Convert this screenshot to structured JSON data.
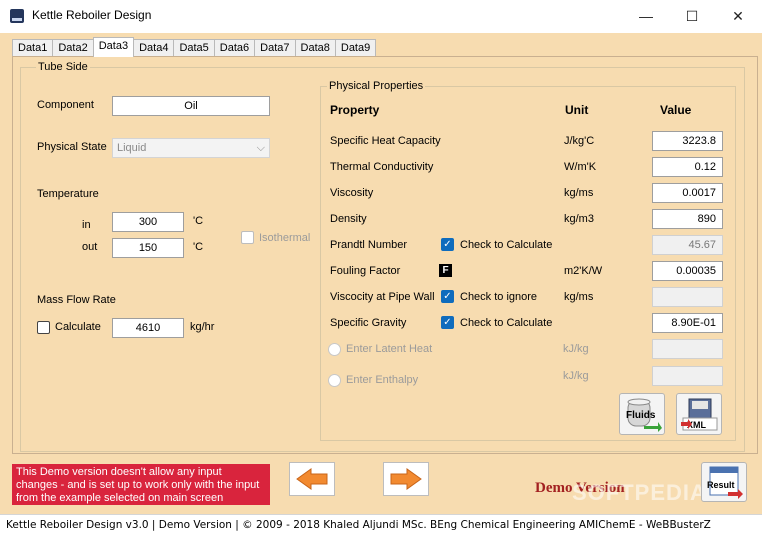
{
  "window": {
    "title": "Kettle Reboiler Design",
    "minimize": "—",
    "maximize": "☐",
    "close": "✕"
  },
  "tabs": [
    "Data1",
    "Data2",
    "Data3",
    "Data4",
    "Data5",
    "Data6",
    "Data7",
    "Data8",
    "Data9"
  ],
  "active_tab": "Data3",
  "tube_side": {
    "title": "Tube Side",
    "component_label": "Component",
    "component_value": "Oil",
    "physical_state_label": "Physical State",
    "physical_state_value": "Liquid",
    "temperature_label": "Temperature",
    "in_label": "in",
    "in_value": "300",
    "out_label": "out",
    "out_value": "150",
    "temp_unit": "'C",
    "isothermal_label": "Isothermal",
    "mass_flow_label": "Mass Flow Rate",
    "calculate_label": "Calculate",
    "mass_flow_value": "4610",
    "mass_flow_unit": "kg/hr"
  },
  "physical_properties": {
    "title": "Physical Properties",
    "col_property": "Property",
    "col_unit": "Unit",
    "col_value": "Value",
    "rows": [
      {
        "name": "Specific Heat Capacity",
        "unit": "J/kg'C",
        "value": "3223.8"
      },
      {
        "name": "Thermal Conductivity",
        "unit": "W/m'K",
        "value": "0.12"
      },
      {
        "name": "Viscosity",
        "unit": "kg/ms",
        "value": "0.0017"
      },
      {
        "name": "Density",
        "unit": "kg/m3",
        "value": "890"
      },
      {
        "name": "Prandtl Number",
        "check": "Check to Calculate",
        "unit": "",
        "value": "45.67"
      },
      {
        "name": "Fouling Factor",
        "icon": "F",
        "unit": "m2'K/W",
        "value": "0.00035"
      },
      {
        "name": "Viscocity at Pipe Wall",
        "check": "Check to ignore",
        "unit": "kg/ms",
        "value": ""
      },
      {
        "name": "Specific Gravity",
        "check": "Check to Calculate",
        "unit": "",
        "value": "8.90E-01"
      }
    ],
    "latent_heat_label": "Enter Latent Heat",
    "latent_heat_unit": "kJ/kg",
    "enthalpy_label": "Enter Enthalpy",
    "enthalpy_unit": "kJ/kg",
    "fluids_button": "Fluids",
    "xml_button": "XML"
  },
  "footer": {
    "demo_notice": "This Demo version doesn't allow any input changes - and is set up to work only with the input from the example selected on main screen",
    "demo_version": "Demo Version",
    "watermark": "SOFTPEDIA",
    "result_button": "Result",
    "status": "Kettle Reboiler Design  v3.0  |  Demo Version  |  © 2009 - 2018 Khaled Aljundi MSc. BEng Chemical Engineering AMIChemE - WeBBusterZ"
  },
  "colors": {
    "panel": "#f7dcb0",
    "notice": "#d9243d",
    "arrow": "#f28a30",
    "check": "#0f6cbd"
  }
}
